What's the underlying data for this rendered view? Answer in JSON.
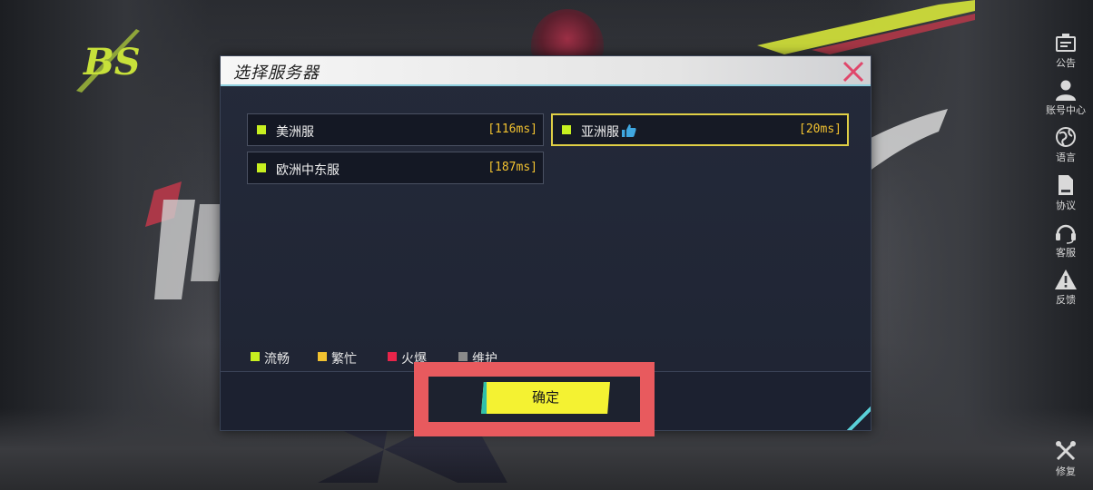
{
  "dialog": {
    "title": "选择服务器",
    "confirm_label": "确定"
  },
  "servers": [
    {
      "name": "美洲服",
      "ping": "[116ms]",
      "status": "流畅",
      "selected": false,
      "recommended": false
    },
    {
      "name": "亚洲服",
      "ping": "[20ms]",
      "status": "流畅",
      "selected": true,
      "recommended": true
    },
    {
      "name": "欧洲中东服",
      "ping": "[187ms]",
      "status": "流畅",
      "selected": false,
      "recommended": false
    }
  ],
  "legend": [
    {
      "label": "流畅",
      "color": "#c8f020"
    },
    {
      "label": "繁忙",
      "color": "#f2c230"
    },
    {
      "label": "火爆",
      "color": "#e8254a"
    },
    {
      "label": "维护",
      "color": "#8a8a8a"
    }
  ],
  "side_menu": [
    {
      "label": "公告",
      "icon": "announcement-icon"
    },
    {
      "label": "账号中心",
      "icon": "account-icon"
    },
    {
      "label": "语言",
      "icon": "globe-icon"
    },
    {
      "label": "协议",
      "icon": "document-icon"
    },
    {
      "label": "客服",
      "icon": "headset-icon"
    },
    {
      "label": "反馈",
      "icon": "warning-icon"
    }
  ],
  "repair": {
    "label": "修复",
    "icon": "wrench-icon"
  },
  "colors": {
    "accent_yellow": "#f4f232",
    "ping_text": "#f2c230",
    "highlight_red": "#e85a5e",
    "selected_border": "#e0cf45"
  }
}
